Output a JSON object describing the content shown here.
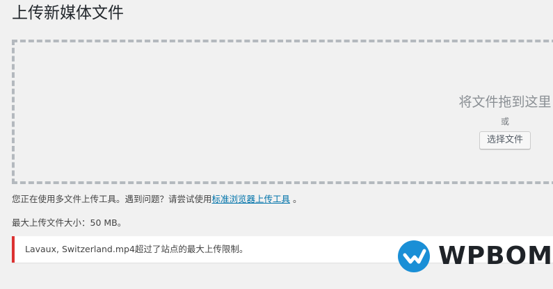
{
  "page": {
    "title": "上传新媒体文件"
  },
  "dropzone": {
    "title": "将文件拖到这里",
    "or_text": "或",
    "select_button_label": "选择文件"
  },
  "info": {
    "prefix": "您正在使用多文件上传工具。遇到问题？请尝试使用",
    "link_text": "标准浏览器上传工具",
    "suffix": " 。"
  },
  "max_size": {
    "text": "最大上传文件大小：50 MB。"
  },
  "error": {
    "message": "Lavaux, Switzerland.mp4超过了站点的最大上传限制。",
    "border_color": "#dc3232"
  },
  "watermark": {
    "text": "WPBOM",
    "icon": "wpbom-logo-icon",
    "color": "#1a8fd6"
  }
}
